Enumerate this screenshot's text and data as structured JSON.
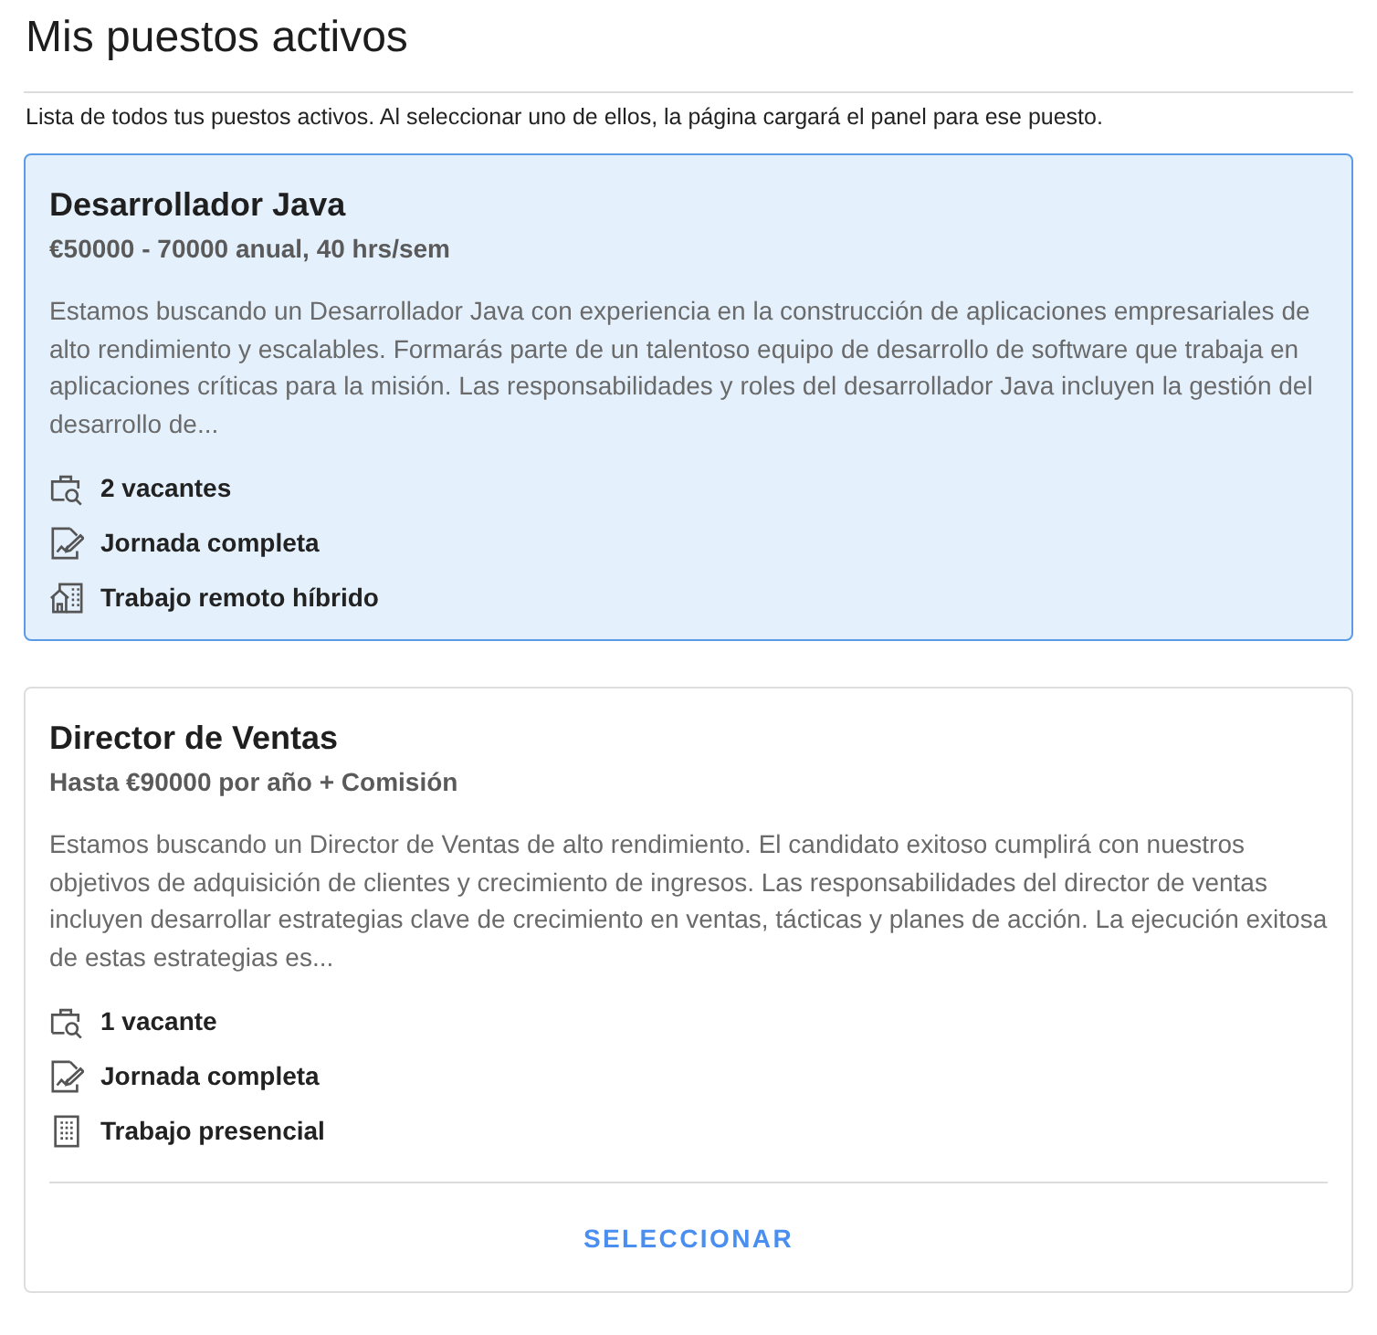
{
  "page": {
    "title": "Mis puestos activos",
    "description": "Lista de todos tus puestos activos. Al seleccionar uno de ellos, la página cargará el panel para ese puesto."
  },
  "jobs": [
    {
      "title": "Desarrollador Java",
      "salary": "€50000 - 70000 anual, 40 hrs/sem",
      "description": "Estamos buscando un Desarrollador Java con experiencia en la construcción de aplicaciones empresariales de alto rendimiento y escalables. Formarás parte de un talentoso equipo de desarrollo de software que trabaja en aplicaciones críticas para la misión. Las responsabilidades y roles del desarrollador Java incluyen la gestión del desarrollo de...",
      "selected": true,
      "features": [
        {
          "kind": "openings",
          "label": "2 vacantes"
        },
        {
          "kind": "schedule",
          "label": "Jornada completa"
        },
        {
          "kind": "hybrid",
          "label": "Trabajo remoto híbrido"
        }
      ]
    },
    {
      "title": "Director de Ventas",
      "salary": "Hasta €90000 por año + Comisión",
      "description": "Estamos buscando un Director de Ventas de alto rendimiento. El candidato exitoso cumplirá con nuestros objetivos de adquisición de clientes y crecimiento de ingresos. Las responsabilidades del director de ventas incluyen desarrollar estrategias clave de crecimiento en ventas, tácticas y planes de acción. La ejecución exitosa de estas estrategias es...",
      "selected": false,
      "features": [
        {
          "kind": "openings",
          "label": "1 vacante"
        },
        {
          "kind": "schedule",
          "label": "Jornada completa"
        },
        {
          "kind": "onsite",
          "label": "Trabajo presencial"
        }
      ],
      "button": "SELECCIONAR"
    }
  ]
}
